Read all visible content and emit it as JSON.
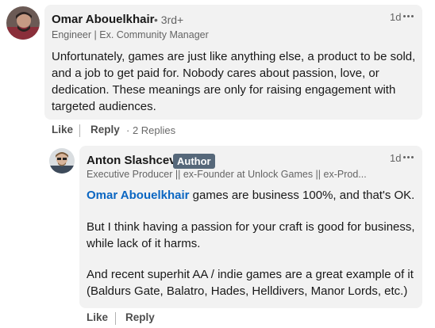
{
  "comment": {
    "author_name": "Omar Abouelkhair",
    "degree": "• 3rd+",
    "headline": "Engineer | Ex. Community Manager",
    "time": "1d",
    "body_lines": [
      "Unfortunately, games are just like anything else, a product to be sold,",
      "and a job to get paid for. Nobody cares about passion, love, or",
      "dedication. These meanings are only for raising engagement with",
      "targeted audiences."
    ],
    "actions": {
      "like": "Like",
      "reply": "Reply",
      "replies_count": "· 2 Replies"
    },
    "avatar_icon": "profile-photo-icon"
  },
  "reply": {
    "author_name": "Anton Slashcev",
    "badge": "Author",
    "headline": "Executive Producer || ex-Founder at Unlock Games || ex-Prod...",
    "time": "1d",
    "mention": "Omar Abouelkhair",
    "line1_rest": " games are business 100%, and that's OK.",
    "para2_lines": [
      "But I think having a passion for your craft is good for business,",
      "while lack of it harms."
    ],
    "para3_lines": [
      "And recent superhit AA / indie games are a great example of it",
      "(Baldurs Gate, Balatro, Hades, Helldivers, Manor Lords, etc.)"
    ],
    "actions": {
      "like": "Like",
      "reply": "Reply"
    },
    "avatar_icon": "profile-photo-icon"
  },
  "colors": {
    "bubble": "#f2f2f2",
    "mention": "#0a66c2",
    "badge": "#56687a"
  }
}
